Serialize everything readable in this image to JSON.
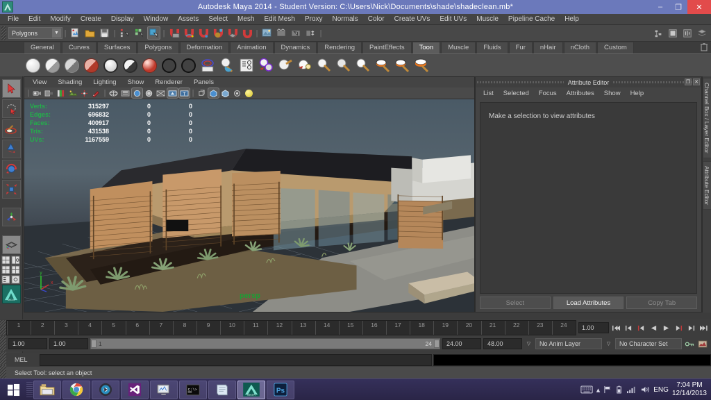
{
  "window": {
    "title": "Autodesk Maya 2014 - Student Version: C:\\Users\\Nick\\Documents\\shade\\shadeclean.mb*",
    "minimize_label": "–",
    "maximize_label": "❐",
    "close_label": "✕"
  },
  "menubar": {
    "items": [
      "File",
      "Edit",
      "Modify",
      "Create",
      "Display",
      "Window",
      "Assets",
      "Select",
      "Mesh",
      "Edit Mesh",
      "Proxy",
      "Normals",
      "Color",
      "Create UVs",
      "Edit UVs",
      "Muscle",
      "Pipeline Cache",
      "Help"
    ]
  },
  "toolbar": {
    "menuset": "Polygons",
    "menuset_arrow": "▼"
  },
  "shelf": {
    "tabs": [
      "General",
      "Curves",
      "Surfaces",
      "Polygons",
      "Deformation",
      "Animation",
      "Dynamics",
      "Rendering",
      "PaintEffects",
      "Toon",
      "Muscle",
      "Fluids",
      "Fur",
      "nHair",
      "nCloth",
      "Custom"
    ],
    "active_tab": "Toon",
    "trash_icon": "trash-icon"
  },
  "toolbox": {
    "tools": [
      "select-tool",
      "lasso-select-tool",
      "paint-select-tool",
      "move-tool",
      "rotate-tool",
      "scale-tool",
      "last-tool",
      "show-manipulator-tool"
    ],
    "layout_presets": [
      "single-perspective-layout",
      "four-view-layout",
      "persp-outliner-layout",
      "outliner-persp-layout",
      "hypergraph-layout",
      "maya-logo"
    ]
  },
  "viewport": {
    "menus": [
      "View",
      "Shading",
      "Lighting",
      "Show",
      "Renderer",
      "Panels"
    ],
    "camera_label": "persp",
    "axis_y": "y",
    "axis_x": "x",
    "hud": {
      "columns": 3,
      "rows": [
        {
          "label": "Verts:",
          "total": "315297",
          "selected": "0",
          "visible": "0"
        },
        {
          "label": "Edges:",
          "total": "696832",
          "selected": "0",
          "visible": "0"
        },
        {
          "label": "Faces:",
          "total": "400917",
          "selected": "0",
          "visible": "0"
        },
        {
          "label": "Tris:",
          "total": "431538",
          "selected": "0",
          "visible": "0"
        },
        {
          "label": "UVs:",
          "total": "1167559",
          "selected": "0",
          "visible": "0"
        }
      ]
    }
  },
  "attribute_editor": {
    "title": "Attribute Editor",
    "menus": [
      "List",
      "Selected",
      "Focus",
      "Attributes",
      "Show",
      "Help"
    ],
    "empty_message": "Make a selection to view attributes",
    "buttons": [
      "Select",
      "Load Attributes",
      "Copy Tab"
    ],
    "undock_label": "❐",
    "close_label": "✕"
  },
  "right_tabs": {
    "items": [
      "Channel Box / Layer Editor",
      "Attribute Editor"
    ]
  },
  "timeline": {
    "start": 1,
    "end": 24,
    "ticks": [
      1,
      2,
      3,
      4,
      5,
      6,
      7,
      8,
      9,
      10,
      11,
      12,
      13,
      14,
      15,
      16,
      17,
      18,
      19,
      20,
      21,
      22,
      23,
      24
    ],
    "current_frame": "1.00",
    "playback_buttons": [
      "go-to-start",
      "step-back-key",
      "step-back-frame",
      "play-backwards",
      "play-forwards",
      "step-forward-frame",
      "step-forward-key",
      "go-to-end"
    ]
  },
  "range_slider": {
    "anim_start": "1.00",
    "anim_current_start": "1.00",
    "range_low": "1",
    "range_high": "24",
    "playback_end": "24.00",
    "anim_end": "48.00",
    "anim_layer": "No Anim Layer",
    "character_set": "No Character Set",
    "key_icon": "key-icon",
    "prefs_icon": "animation-preferences-icon"
  },
  "command_line": {
    "language": "MEL",
    "input_value": "",
    "output_value": ""
  },
  "status_bar": {
    "message": "Select Tool: select an object"
  },
  "taskbar": {
    "start_label": "start-button",
    "apps": [
      {
        "name": "file-explorer",
        "glyph": "🗂"
      },
      {
        "name": "google-chrome",
        "glyph": "chrome"
      },
      {
        "name": "media-player",
        "glyph": "disc"
      },
      {
        "name": "visual-studio",
        "glyph": "∞"
      },
      {
        "name": "system-monitor",
        "glyph": "monitor"
      },
      {
        "name": "command-prompt",
        "glyph": "C:\\>"
      },
      {
        "name": "notepad",
        "glyph": "note"
      },
      {
        "name": "autodesk-maya",
        "glyph": "MAYA"
      },
      {
        "name": "adobe-photoshop",
        "glyph": "Ps"
      }
    ],
    "tray": {
      "keyboard_icon": "keyboard-icon",
      "show_hidden_icon": "▴",
      "flag_icon": "action-center-icon",
      "battery_icon": "battery-icon",
      "network_icon": "network-signal-icon",
      "volume_icon": "🔊",
      "language": "ENG",
      "time": "7:04 PM",
      "date": "12/14/2013"
    }
  },
  "colors": {
    "titlebar": "#6b79bb",
    "close_button": "#e24b4b",
    "hud_label": "#23b04a",
    "camera_label": "#1f9b35",
    "panel_bg": "#444444"
  }
}
